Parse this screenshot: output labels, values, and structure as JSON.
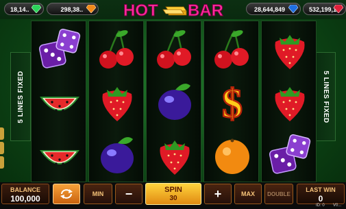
{
  "jackpots": [
    {
      "value": "18,14.."
    },
    {
      "value": "298,38.."
    },
    {
      "value": "28,644,849"
    },
    {
      "value": "532,199,1.."
    }
  ],
  "logo": {
    "word1": "HOT",
    "word2": "BAR"
  },
  "side_panels": {
    "left": "5 LINES FIXED",
    "right": "5 LINES FIXED"
  },
  "reels": [
    [
      "dice-icon",
      "watermelon-icon",
      "watermelon-icon"
    ],
    [
      "cherry-icon",
      "strawberry-icon",
      "plum-icon"
    ],
    [
      "cherry-icon",
      "plum-icon",
      "strawberry-icon"
    ],
    [
      "cherry-icon",
      "dollar-icon",
      "orange-icon"
    ],
    [
      "strawberry-icon",
      "strawberry-icon",
      "dice-icon"
    ]
  ],
  "bottom": {
    "balance_label": "BALANCE",
    "balance_value": "100,000",
    "min_label": "MIN",
    "minus_label": "−",
    "spin_label": "SPIN",
    "bet_value": "30",
    "plus_label": "+",
    "max_label": "MAX",
    "double_label": "DOUBLE",
    "last_win_label": "LAST WIN",
    "last_win_value": "0"
  },
  "status": {
    "id_label": "ID: 0",
    "version": "V0..."
  },
  "colors": {
    "accent": "#f7a23a",
    "background": "#0e4a17",
    "spin": "#ffd43d"
  }
}
